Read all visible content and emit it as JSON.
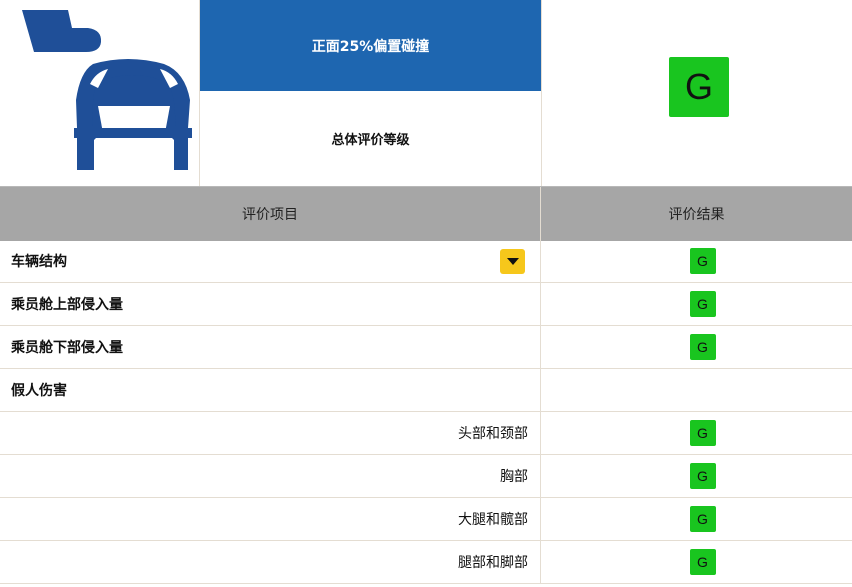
{
  "header": {
    "test_title": "正面25%偏置碰撞",
    "overall_label": "总体评价等级",
    "overall_rating": "G",
    "col_item": "评价项目",
    "col_result": "评价结果"
  },
  "icon": "small-overlap-frontal-crash-icon",
  "colors": {
    "title_bar": "#1e66b0",
    "header_bar": "#a6a6a6",
    "rating_good": "#19c51f",
    "dropdown": "#f6c71b",
    "icon_blue": "#1f4f98"
  },
  "rows": [
    {
      "label": "车辆结构",
      "rating": "G"
    },
    {
      "label": "乘员舱上部侵入量",
      "rating": "G"
    },
    {
      "label": "乘员舱下部侵入量",
      "rating": "G"
    },
    {
      "label": "假人伤害",
      "rating": ""
    },
    {
      "label": "头部和颈部",
      "rating": "G"
    },
    {
      "label": "胸部",
      "rating": "G"
    },
    {
      "label": "大腿和髋部",
      "rating": "G"
    },
    {
      "label": "腿部和脚部",
      "rating": "G"
    }
  ]
}
